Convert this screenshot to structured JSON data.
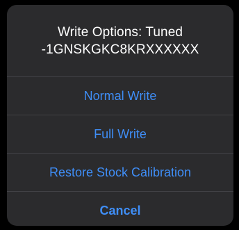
{
  "alert": {
    "title_line1": "Write Options: Tuned",
    "title_line2": "-1GNSKGKC8KRXXXXXX",
    "actions": [
      {
        "label": "Normal Write"
      },
      {
        "label": "Full Write"
      },
      {
        "label": "Restore Stock Calibration"
      },
      {
        "label": "Cancel"
      }
    ]
  },
  "colors": {
    "background": "#000000",
    "alert_background": "#2b2b2d",
    "title_text": "#ffffff",
    "action_text": "#3f8ef7",
    "separator": "#414145"
  }
}
